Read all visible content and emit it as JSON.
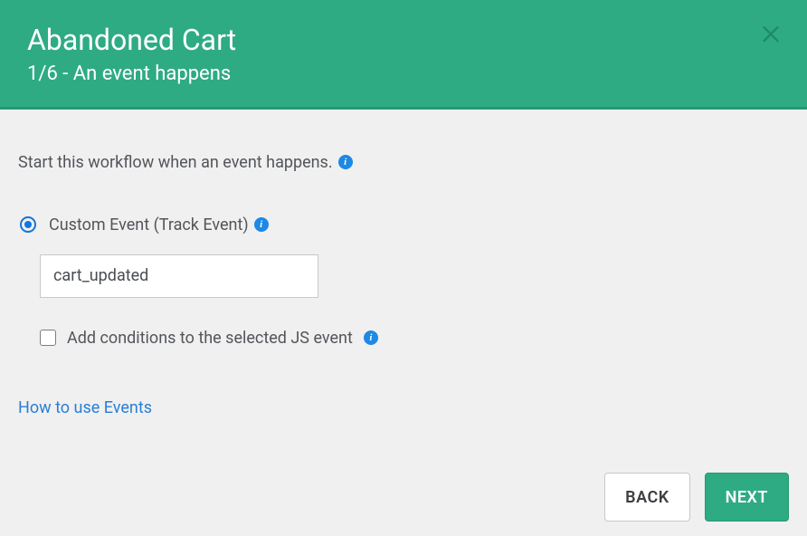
{
  "header": {
    "title": "Abandoned Cart",
    "subtitle": "1/6 - An event happens"
  },
  "body": {
    "intro": "Start this workflow when an event happens.",
    "radio_label": "Custom Event (Track Event)",
    "event_value": "cart_updated",
    "conditions_label": "Add conditions to the selected JS event",
    "help_link": "How to use Events"
  },
  "footer": {
    "back": "BACK",
    "next": "NEXT"
  },
  "info_glyph": "i"
}
